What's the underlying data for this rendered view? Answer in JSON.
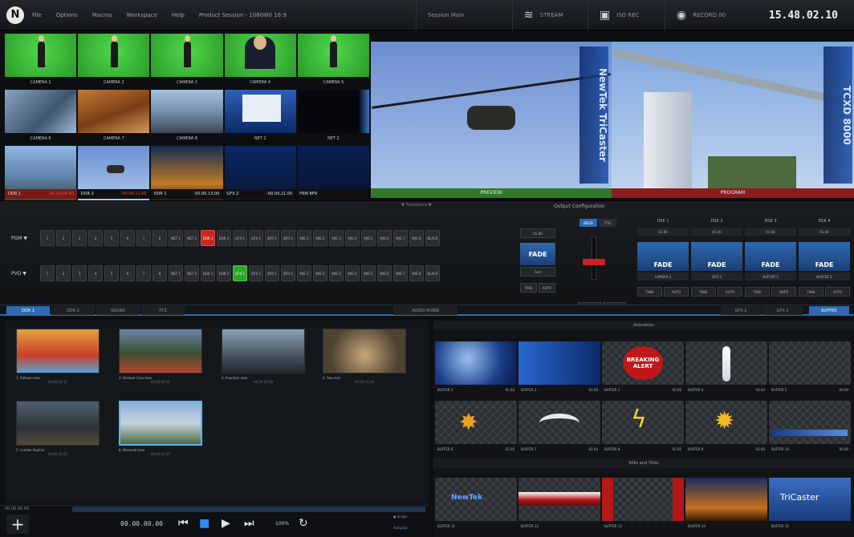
{
  "topbar": {
    "menu": [
      "File",
      "Options",
      "Macros",
      "Workspace",
      "Help",
      "Product Session - 1080i60 16:9"
    ],
    "session_label": "Session Main",
    "stream_label": "STREAM",
    "record_label": "ISO REC",
    "record_status": "RECORD 00",
    "clock": "15.48.02.10"
  },
  "monitors": [
    {
      "label": "CAMERA 1"
    },
    {
      "label": "CAMERA 2"
    },
    {
      "label": "CAMERA 3"
    },
    {
      "label": "CAMERA 4"
    },
    {
      "label": "CAMERA 5"
    },
    {
      "label": "CAMERA 6"
    },
    {
      "label": "CAMERA 7"
    },
    {
      "label": "CAMERA 8"
    },
    {
      "label": "NET 1"
    },
    {
      "label": "NET 2"
    },
    {
      "label": ""
    },
    {
      "label": ""
    },
    {
      "label": ""
    },
    {
      "label": ""
    },
    {
      "label": ""
    }
  ],
  "ddr_row": [
    {
      "name": "DDR 1",
      "time": "-00.00.08.00"
    },
    {
      "name": "DDR 2",
      "time": "-00.00.11.00"
    },
    {
      "name": "DDR 1",
      "time": "-00.00.13.00"
    },
    {
      "name": "GFX 2",
      "time": "-00.00.21.00"
    },
    {
      "name": "FRM BFR",
      "time": ""
    }
  ],
  "preview": {
    "label": "PREVIEW",
    "overlay": "NewTek TriCaster"
  },
  "program": {
    "label": "PROGRAM",
    "overlay": "TCXD 8000"
  },
  "switcher": {
    "subhead": "▼ Transitions ▼",
    "output_config": "Output Configuration",
    "program_bus": "PGM ▼",
    "preview_bus": "PVD ▼",
    "program_buttons": [
      "1",
      "2",
      "3",
      "4",
      "5",
      "6",
      "7",
      "8",
      "NET 1",
      "NET 2",
      "DDR 1",
      "DDR 2",
      "GFX 1",
      "GFX 2",
      "BFR 1",
      "BFR 2",
      "M/E 1",
      "M/E 2",
      "M/E 3",
      "M/E 4",
      "M/E 5",
      "M/E 6",
      "M/E 7",
      "M/E 8",
      "BLACK"
    ],
    "preview_buttons": [
      "1",
      "2",
      "3",
      "4",
      "5",
      "6",
      "7",
      "8",
      "NET 1",
      "NET 2",
      "DDR 1",
      "DDR 2",
      "GFX 1",
      "GFX 2",
      "BFR 1",
      "BFR 2",
      "M/E 1",
      "M/E 2",
      "M/E 3",
      "M/E 4",
      "M/E 5",
      "M/E 6",
      "M/E 7",
      "M/E 8",
      "BLACK"
    ],
    "program_active_index": 10,
    "preview_active_index": 12,
    "bkgd_tabs": [
      "BKGD",
      "FTB"
    ],
    "main_transition": {
      "duration": "01.00",
      "name": "FADE",
      "speed": "Fast",
      "take": "TAKE",
      "auto": "AUTO"
    },
    "dsk": [
      {
        "name": "DSK 1",
        "duration": "01.00",
        "transition": "FADE",
        "source": "CAMERA 1",
        "take": "TAKE",
        "auto": "AUTO"
      },
      {
        "name": "DSK 2",
        "duration": "01.00",
        "transition": "FADE",
        "source": "GFX 2",
        "take": "TAKE",
        "auto": "AUTO"
      },
      {
        "name": "DSK 3",
        "duration": "01.00",
        "transition": "FADE",
        "source": "BUFFER 3",
        "take": "TAKE",
        "auto": "AUTO"
      },
      {
        "name": "DSK 4",
        "duration": "01.00",
        "transition": "FADE",
        "source": "BUFFER 2",
        "take": "TAKE",
        "auto": "AUTO"
      }
    ]
  },
  "tabs": {
    "left": [
      "DDR 1",
      "DDR 2",
      "SOUND",
      "PTZ"
    ],
    "center": "AUDIO MIXER",
    "right": [
      "GFX 1",
      "GFX 2",
      "BUFFER"
    ],
    "active_left": "DDR 1",
    "active_right": "BUFFER"
  },
  "media": {
    "clips": [
      {
        "name": "1. Balloon.mov",
        "dur": "00.00.12.11",
        "sel": false
      },
      {
        "name": "2. Bumper Cars.mov",
        "dur": "00.00.09.01",
        "sel": false
      },
      {
        "name": "3. Fountain.mov",
        "dur": "00.00.14.19",
        "sel": false
      },
      {
        "name": "4. Sea.mov",
        "dur": "00.00.11.20",
        "sel": false
      },
      {
        "name": "5. London Skyline",
        "dur": "00.00.10.23",
        "sel": false
      },
      {
        "name": "6. Monorail.mov",
        "dur": "00.00.12.07",
        "sel": true
      }
    ],
    "position_small": "00.00.00.00",
    "timecode": "00.00.00.00",
    "speed": "100%",
    "mode_1": "● Single",
    "mode_2": "Autoplay"
  },
  "buffers": {
    "animation_header": "Animation",
    "stills_header": "Stills and Titles",
    "animation": [
      {
        "name": "BUFFER 1",
        "time": "05.02"
      },
      {
        "name": "BUFFER 2",
        "time": "01.00"
      },
      {
        "name": "BUFFER 3",
        "time": "02.00"
      },
      {
        "name": "BUFFER 4",
        "time": "03.04"
      },
      {
        "name": "BUFFER 5",
        "time": "06.00"
      },
      {
        "name": "BUFFER 6",
        "time": "02.00"
      },
      {
        "name": "BUFFER 7",
        "time": "02.04"
      },
      {
        "name": "BUFFER 8",
        "time": "02.00"
      },
      {
        "name": "BUFFER 9",
        "time": "02.00"
      },
      {
        "name": "BUFFER 10",
        "time": "06.00"
      }
    ],
    "stills": [
      {
        "name": "BUFFER 11"
      },
      {
        "name": "BUFFER 12"
      },
      {
        "name": "BUFFER 13"
      },
      {
        "name": "BUFFER 14"
      },
      {
        "name": "BUFFER 15"
      }
    ],
    "alert_text": "BREAKING ALERT",
    "newtek_logo": "NewTek",
    "tricaster_logo": "TriCaster"
  }
}
